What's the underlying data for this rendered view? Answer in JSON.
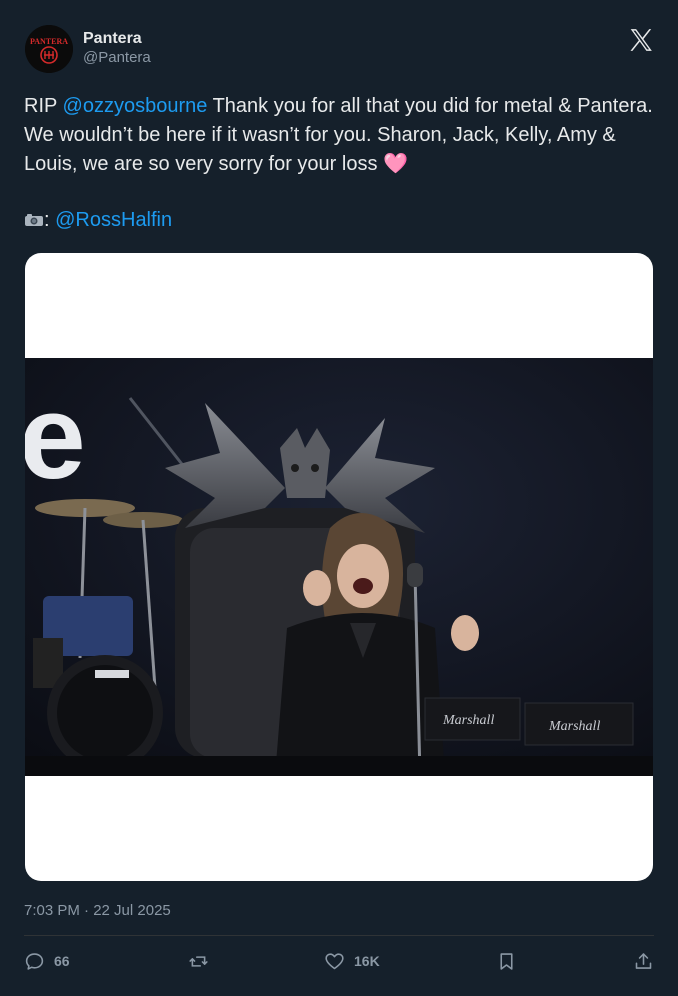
{
  "author": {
    "name": "Pantera",
    "handle": "@Pantera",
    "avatar_text": "PANTERA"
  },
  "tweet": {
    "segments": [
      {
        "type": "text",
        "text": "RIP "
      },
      {
        "type": "mention",
        "text": "@ozzyosbourne"
      },
      {
        "type": "text",
        "text": " Thank you for all that you did for metal & Pantera. We wouldn’t be here if it wasn’t for you. Sharon, Jack, Kelly, Amy & Louis, we are so very sorry for your loss "
      },
      {
        "type": "emoji",
        "text": "🩷"
      }
    ],
    "credit_separator": ":",
    "credit_mention": "@RossHalfin"
  },
  "media": {
    "stage_text": "e",
    "amp_brand": "Marshall"
  },
  "timestamp": "7:03 PM · 22 Jul 2025",
  "actions": {
    "replies": "66",
    "likes": "16K"
  },
  "colors": {
    "background": "#15202b",
    "accent": "#1d9bf0",
    "muted": "#8b98a5",
    "text": "#e7e9ea"
  },
  "icons": {
    "close": "x-logo-icon",
    "reply": "reply-icon",
    "retweet": "retweet-icon",
    "like": "heart-icon",
    "bookmark": "bookmark-icon",
    "share": "share-icon"
  }
}
